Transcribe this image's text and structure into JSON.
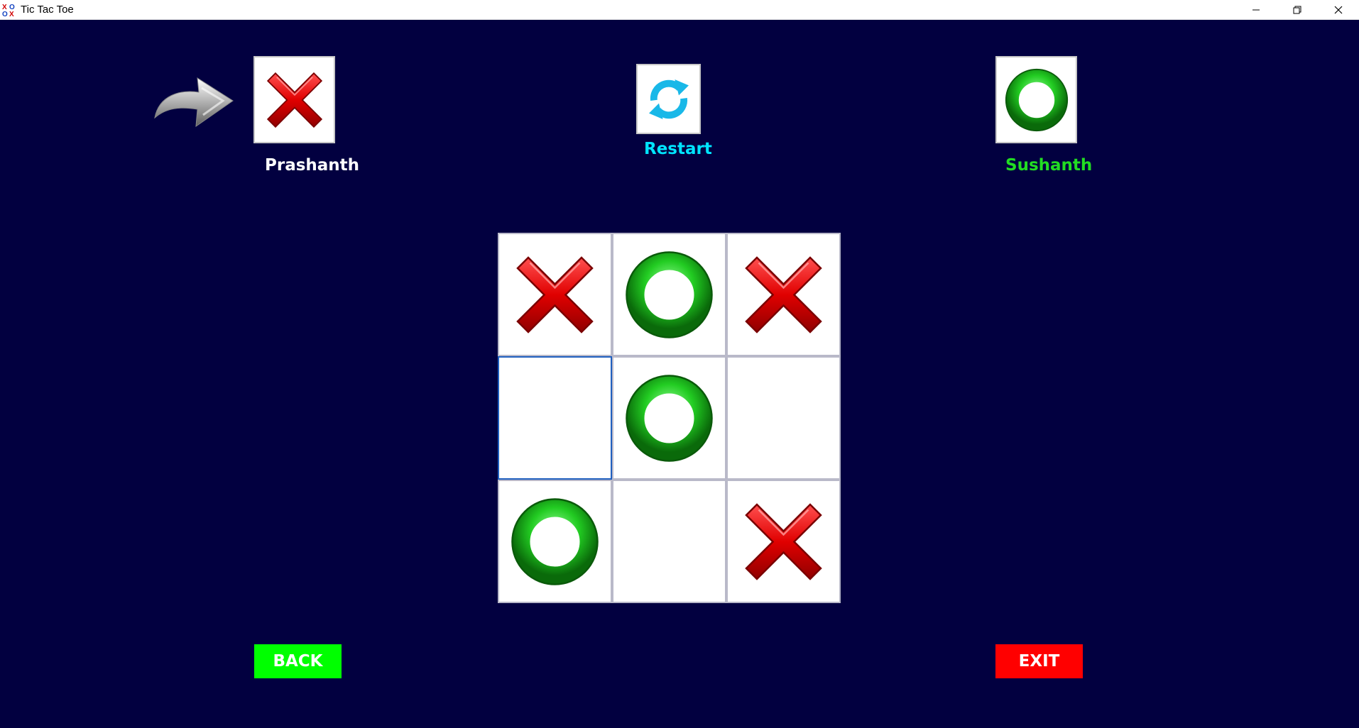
{
  "window": {
    "title": "Tic Tac Toe"
  },
  "players": {
    "player1": {
      "name": "Prashanth",
      "symbol": "X",
      "color": "#ffffff"
    },
    "player2": {
      "name": "Sushanth",
      "symbol": "O",
      "color": "#22dd22"
    },
    "current_turn": "player1"
  },
  "restart": {
    "label": "Restart",
    "color": "#00e5ff"
  },
  "board": {
    "cells": [
      "X",
      "O",
      "X",
      "",
      "O",
      "",
      "O",
      "",
      "X"
    ],
    "selected_index": 3
  },
  "buttons": {
    "back": {
      "label": "BACK",
      "color": "#00ff00"
    },
    "exit": {
      "label": "EXIT",
      "color": "#ff0000"
    }
  },
  "colors": {
    "background": "#020040",
    "x_mark": "#e01010",
    "o_mark": "#22c022"
  }
}
